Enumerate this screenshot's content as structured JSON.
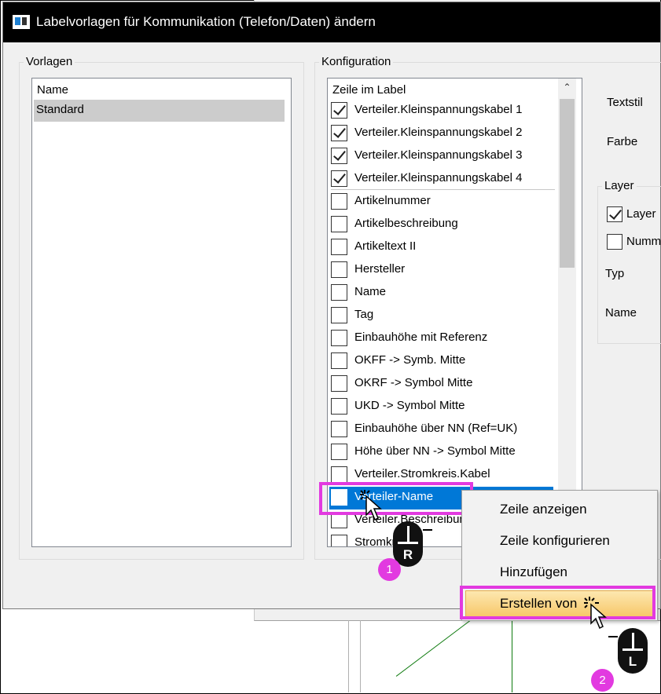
{
  "window": {
    "title": "Labelvorlagen für Kommunikation (Telefon/Daten) ändern"
  },
  "vorlagen": {
    "group_label": "Vorlagen",
    "header": "Name",
    "items": [
      "Standard"
    ]
  },
  "konfiguration": {
    "group_label": "Konfiguration",
    "header": "Zeile im Label",
    "rows": [
      {
        "label": "Verteiler.Kleinspannungskabel 1",
        "checked": true
      },
      {
        "label": "Verteiler.Kleinspannungskabel 2",
        "checked": true
      },
      {
        "label": "Verteiler.Kleinspannungskabel 3",
        "checked": true
      },
      {
        "label": "Verteiler.Kleinspannungskabel 4",
        "checked": true
      },
      {
        "label": "Artikelnummer",
        "checked": false
      },
      {
        "label": "Artikelbeschreibung",
        "checked": false
      },
      {
        "label": "Artikeltext II",
        "checked": false
      },
      {
        "label": "Hersteller",
        "checked": false
      },
      {
        "label": "Name",
        "checked": false
      },
      {
        "label": "Tag",
        "checked": false
      },
      {
        "label": "Einbauhöhe mit Referenz",
        "checked": false
      },
      {
        "label": "OKFF -> Symb. Mitte",
        "checked": false
      },
      {
        "label": "OKRF -> Symbol Mitte",
        "checked": false
      },
      {
        "label": "UKD -> Symbol Mitte",
        "checked": false
      },
      {
        "label": "Einbauhöhe über NN (Ref=UK)",
        "checked": false
      },
      {
        "label": "Höhe über NN -> Symbol Mitte",
        "checked": false
      },
      {
        "label": "Verteiler.Stromkreis.Kabel",
        "checked": false
      },
      {
        "label": "Verteiler-Name",
        "checked": false,
        "selected": true
      },
      {
        "label": "Verteiler.Beschreibung",
        "checked": false
      },
      {
        "label": "Stromkreis",
        "checked": false
      }
    ]
  },
  "right_panel": {
    "textstil": "Textstil",
    "farbe": "Farbe",
    "layer_group": "Layer",
    "layer_checkbox": "Layer",
    "nummer_checkbox": "Numm",
    "typ": "Typ",
    "name": "Name"
  },
  "context_menu": {
    "items": [
      "Zeile anzeigen",
      "Zeile konfigurieren",
      "Hinzufügen",
      "Erstellen von"
    ],
    "highlighted": "Erstellen von"
  },
  "annotations": {
    "step1": "1",
    "step2": "2",
    "mouse_right": "R",
    "mouse_left": "L"
  },
  "colors": {
    "highlight_magenta": "#e23ae0",
    "selection_blue": "#0078d7",
    "menu_highlight": "#f7c86a"
  }
}
